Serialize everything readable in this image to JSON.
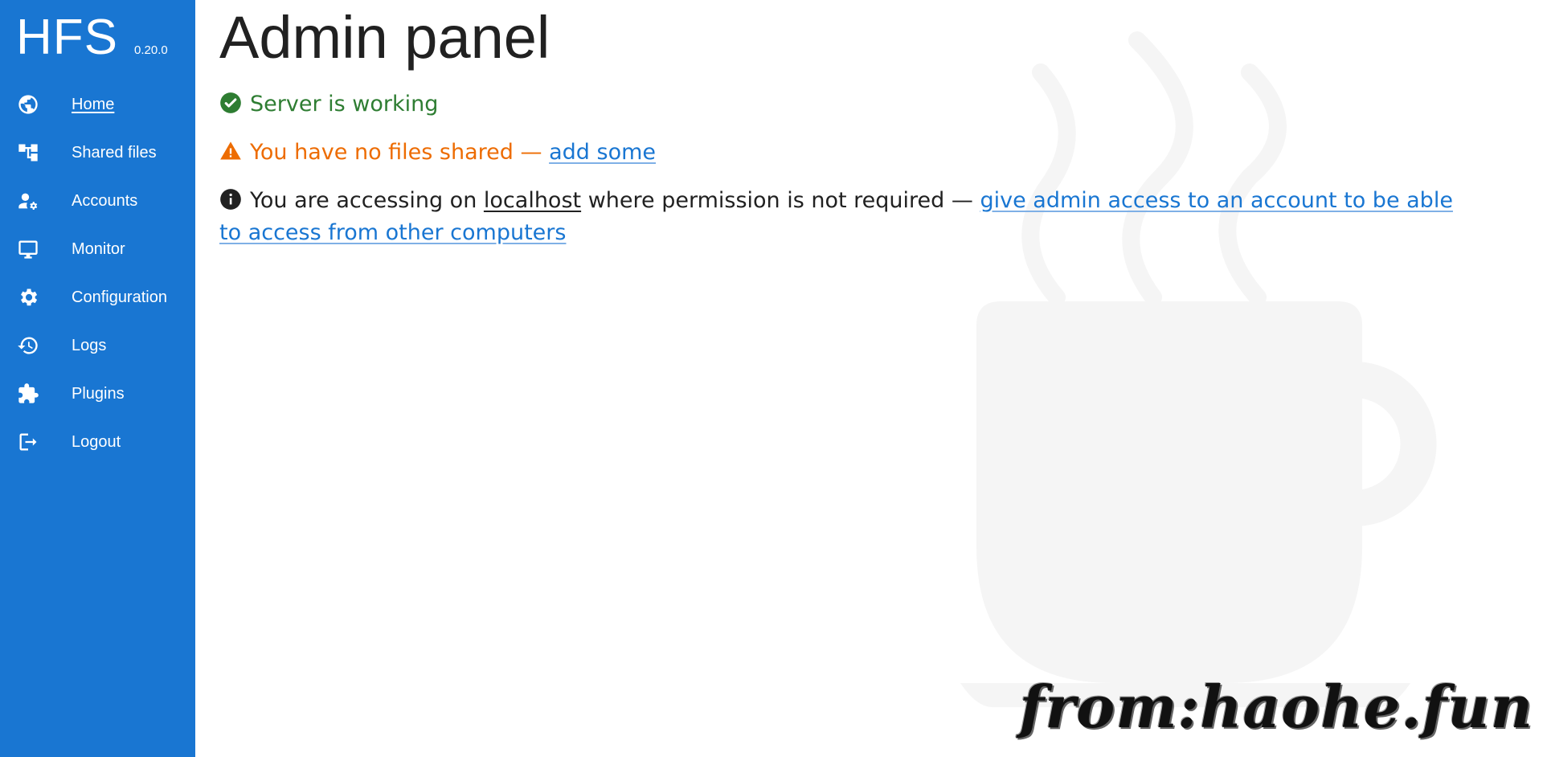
{
  "app": {
    "name": "HFS",
    "version": "0.20.0"
  },
  "sidebar": {
    "items": [
      {
        "label": "Home",
        "icon": "globe-icon",
        "active": true
      },
      {
        "label": "Shared files",
        "icon": "tree-icon"
      },
      {
        "label": "Accounts",
        "icon": "account-settings-icon"
      },
      {
        "label": "Monitor",
        "icon": "monitor-icon"
      },
      {
        "label": "Configuration",
        "icon": "gear-icon"
      },
      {
        "label": "Logs",
        "icon": "history-icon"
      },
      {
        "label": "Plugins",
        "icon": "puzzle-icon"
      },
      {
        "label": "Logout",
        "icon": "logout-icon"
      }
    ]
  },
  "main": {
    "title": "Admin panel",
    "status": {
      "text": "Server is working",
      "icon": "check-circle-icon"
    },
    "warning": {
      "text": "You have no files shared — ",
      "link": "add some",
      "icon": "warning-icon"
    },
    "info": {
      "icon": "info-icon",
      "prefix": "You are accessing on ",
      "host": "localhost",
      "middle": " where permission is not required — ",
      "link": "give admin access to an account to be able to access from other computers"
    }
  },
  "watermark": {
    "text": "from:haohe.fun"
  },
  "colors": {
    "sidebar": "#1976d2",
    "success": "#2e7d32",
    "warning": "#ed6c02",
    "link": "#1976d2"
  }
}
